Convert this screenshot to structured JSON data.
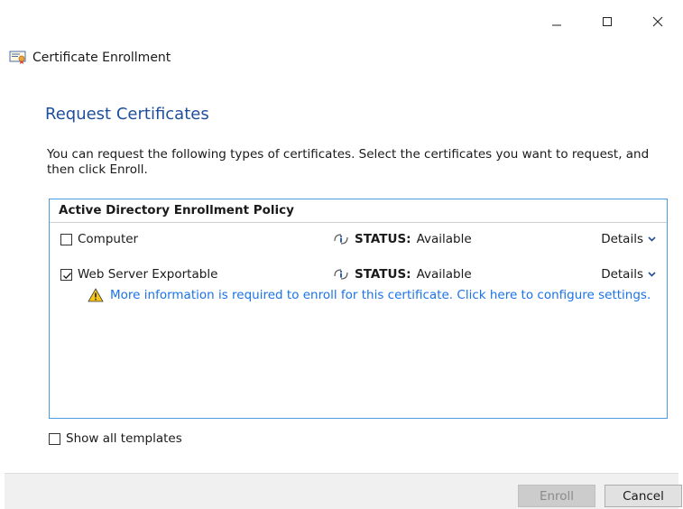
{
  "window": {
    "title": "Certificate Enrollment",
    "controls": {
      "minimize": "minimize",
      "maximize": "maximize",
      "close": "close"
    }
  },
  "page": {
    "heading": "Request Certificates",
    "description": "You can request the following types of certificates. Select the certificates you want to request, and then click Enroll."
  },
  "policy": {
    "header": "Active Directory Enrollment Policy",
    "items": [
      {
        "name": "Computer",
        "checked": false,
        "status_label": "STATUS:",
        "status_value": "Available",
        "details": "Details"
      },
      {
        "name": "Web Server Exportable",
        "checked": true,
        "status_label": "STATUS:",
        "status_value": "Available",
        "details": "Details",
        "warning": "More information is required to enroll for this certificate. Click here to configure settings."
      }
    ]
  },
  "show_all_templates": {
    "label": "Show all templates",
    "checked": false
  },
  "buttons": {
    "enroll": "Enroll",
    "cancel": "Cancel"
  },
  "colors": {
    "accent": "#1f4e9c",
    "link": "#1a73e8",
    "box_border": "#4a9be0",
    "warning": "#f5c518"
  },
  "icons": [
    "certificate-icon",
    "info-icon",
    "chevron-down-icon",
    "warning-icon",
    "minimize-icon",
    "maximize-icon",
    "close-icon"
  ]
}
